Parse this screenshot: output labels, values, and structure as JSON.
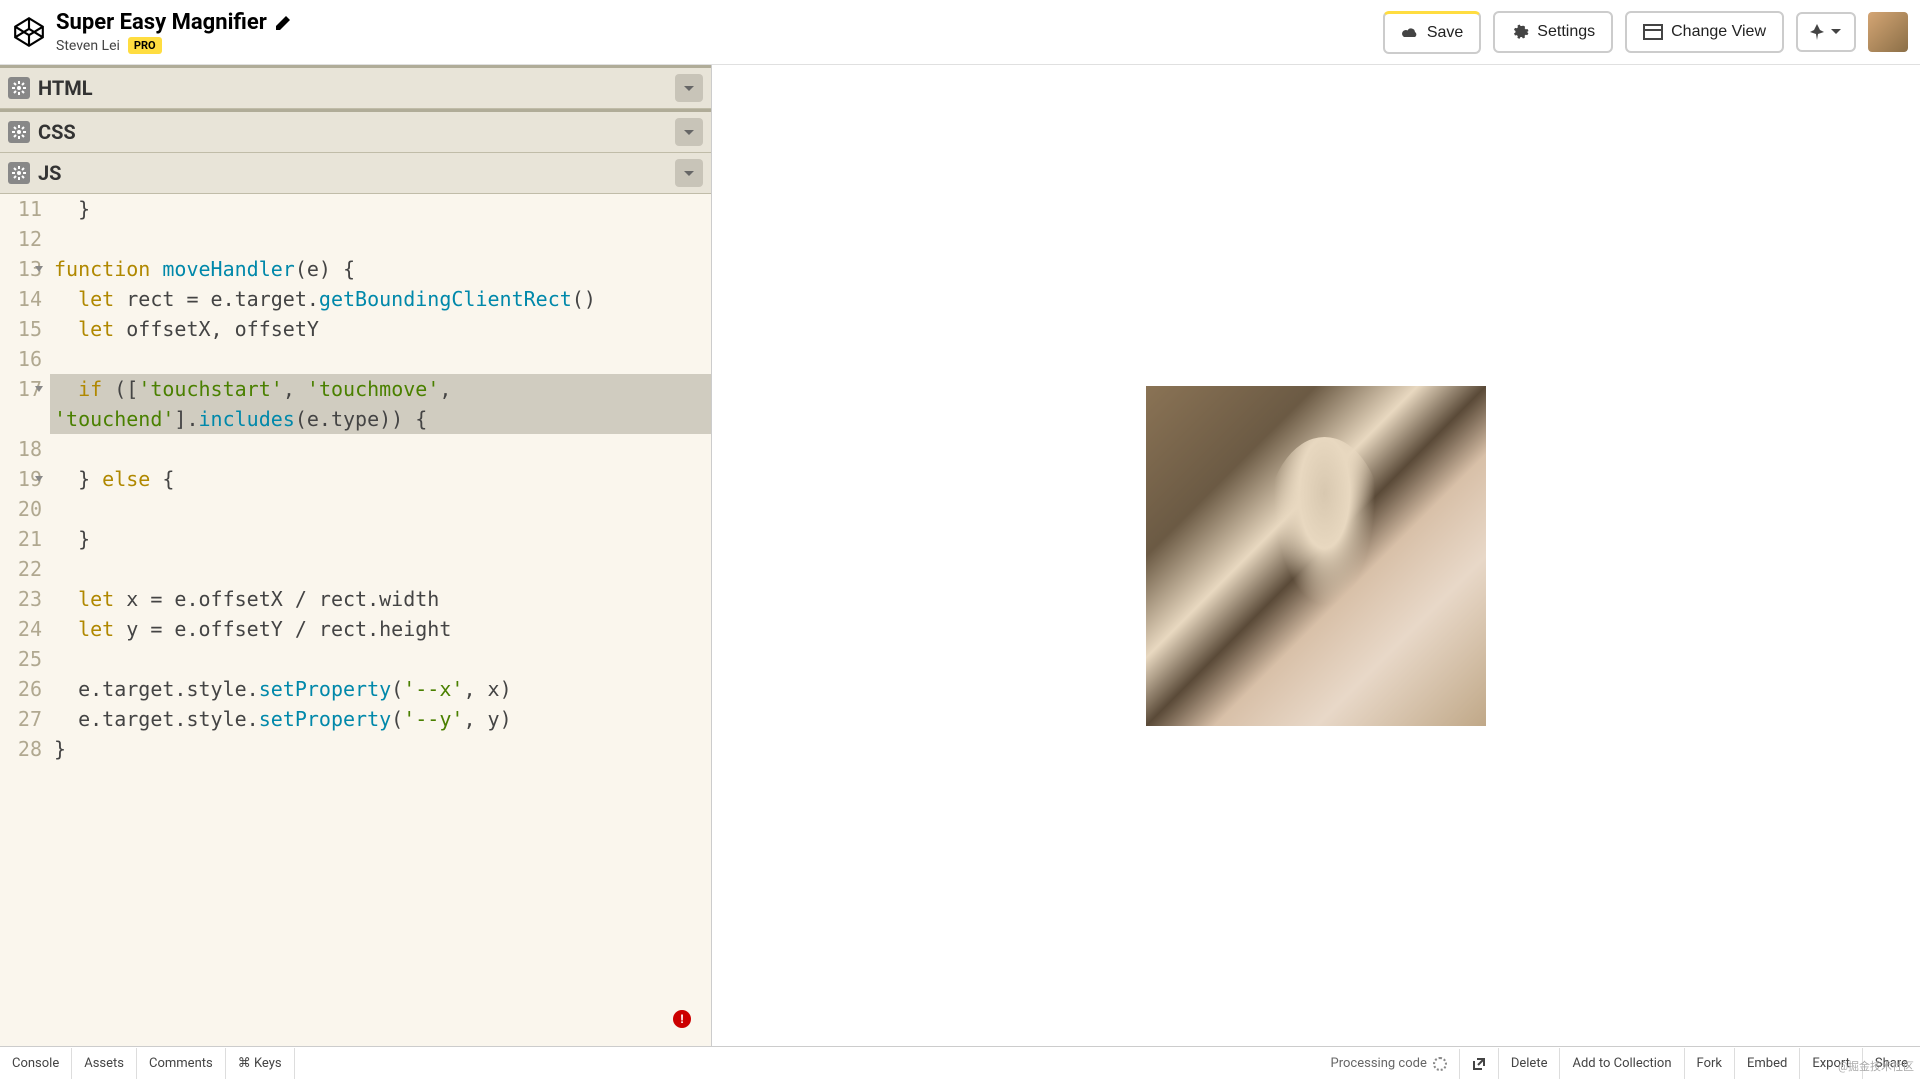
{
  "header": {
    "title": "Super Easy Magnifier",
    "author": "Steven Lei",
    "pro_badge": "PRO",
    "save": "Save",
    "settings": "Settings",
    "change_view": "Change View"
  },
  "panels": {
    "html": "HTML",
    "css": "CSS",
    "js": "JS"
  },
  "code": {
    "lines": [
      {
        "n": "11",
        "fold": false,
        "hl": false,
        "tokens": [
          [
            "pun",
            "  }"
          ]
        ]
      },
      {
        "n": "12",
        "fold": false,
        "hl": false,
        "tokens": []
      },
      {
        "n": "13",
        "fold": true,
        "hl": false,
        "tokens": [
          [
            "kw",
            "function"
          ],
          [
            "pun",
            " "
          ],
          [
            "fn",
            "moveHandler"
          ],
          [
            "pun",
            "("
          ],
          [
            "ident",
            "e"
          ],
          [
            "pun",
            ") {"
          ]
        ]
      },
      {
        "n": "14",
        "fold": false,
        "hl": false,
        "tokens": [
          [
            "pun",
            "  "
          ],
          [
            "kw",
            "let"
          ],
          [
            "pun",
            " "
          ],
          [
            "ident",
            "rect = e.target."
          ],
          [
            "fn",
            "getBoundingClientRect"
          ],
          [
            "pun",
            "()"
          ]
        ]
      },
      {
        "n": "15",
        "fold": false,
        "hl": false,
        "tokens": [
          [
            "pun",
            "  "
          ],
          [
            "kw",
            "let"
          ],
          [
            "pun",
            " "
          ],
          [
            "ident",
            "offsetX, offsetY"
          ]
        ]
      },
      {
        "n": "16",
        "fold": false,
        "hl": false,
        "tokens": []
      },
      {
        "n": "17",
        "fold": true,
        "hl": true,
        "tokens": [
          [
            "pun",
            "  "
          ],
          [
            "kw",
            "if"
          ],
          [
            "pun",
            " (["
          ],
          [
            "str",
            "'touchstart'"
          ],
          [
            "pun",
            ", "
          ],
          [
            "str",
            "'touchmove'"
          ],
          [
            "pun",
            ", "
          ]
        ]
      },
      {
        "n": "",
        "fold": false,
        "hl": true,
        "tokens": [
          [
            "str",
            "'touchend'"
          ],
          [
            "pun",
            "]."
          ],
          [
            "fn",
            "includes"
          ],
          [
            "pun",
            "("
          ],
          [
            "ident",
            "e.type"
          ],
          [
            "pun",
            ")) {"
          ]
        ]
      },
      {
        "n": "18",
        "fold": false,
        "hl": false,
        "tokens": []
      },
      {
        "n": "19",
        "fold": true,
        "hl": false,
        "tokens": [
          [
            "pun",
            "  } "
          ],
          [
            "kw",
            "else"
          ],
          [
            "pun",
            " {"
          ]
        ]
      },
      {
        "n": "20",
        "fold": false,
        "hl": false,
        "tokens": []
      },
      {
        "n": "21",
        "fold": false,
        "hl": false,
        "tokens": [
          [
            "pun",
            "  }"
          ]
        ]
      },
      {
        "n": "22",
        "fold": false,
        "hl": false,
        "tokens": []
      },
      {
        "n": "23",
        "fold": false,
        "hl": false,
        "tokens": [
          [
            "pun",
            "  "
          ],
          [
            "kw",
            "let"
          ],
          [
            "pun",
            " "
          ],
          [
            "ident",
            "x = e.offsetX / rect.width"
          ]
        ]
      },
      {
        "n": "24",
        "fold": false,
        "hl": false,
        "tokens": [
          [
            "pun",
            "  "
          ],
          [
            "kw",
            "let"
          ],
          [
            "pun",
            " "
          ],
          [
            "ident",
            "y = e.offsetY / rect.height"
          ]
        ]
      },
      {
        "n": "25",
        "fold": false,
        "hl": false,
        "tokens": []
      },
      {
        "n": "26",
        "fold": false,
        "hl": false,
        "tokens": [
          [
            "pun",
            "  "
          ],
          [
            "ident",
            "e.target.style."
          ],
          [
            "fn",
            "setProperty"
          ],
          [
            "pun",
            "("
          ],
          [
            "str",
            "'--x'"
          ],
          [
            "pun",
            ", "
          ],
          [
            "ident",
            "x"
          ],
          [
            "pun",
            ")"
          ]
        ]
      },
      {
        "n": "27",
        "fold": false,
        "hl": false,
        "tokens": [
          [
            "pun",
            "  "
          ],
          [
            "ident",
            "e.target.style."
          ],
          [
            "fn",
            "setProperty"
          ],
          [
            "pun",
            "("
          ],
          [
            "str",
            "'--y'"
          ],
          [
            "pun",
            ", "
          ],
          [
            "ident",
            "y"
          ],
          [
            "pun",
            ")"
          ]
        ]
      },
      {
        "n": "28",
        "fold": false,
        "hl": false,
        "tokens": [
          [
            "pun",
            "}"
          ]
        ]
      }
    ],
    "error_indicator": "!"
  },
  "footer": {
    "console": "Console",
    "assets": "Assets",
    "comments": "Comments",
    "keys": "⌘ Keys",
    "status": "Processing code",
    "delete": "Delete",
    "add_collection": "Add to Collection",
    "fork": "Fork",
    "embed": "Embed",
    "export": "Export",
    "share": "Share"
  },
  "watermark": "@掘金技术社区"
}
